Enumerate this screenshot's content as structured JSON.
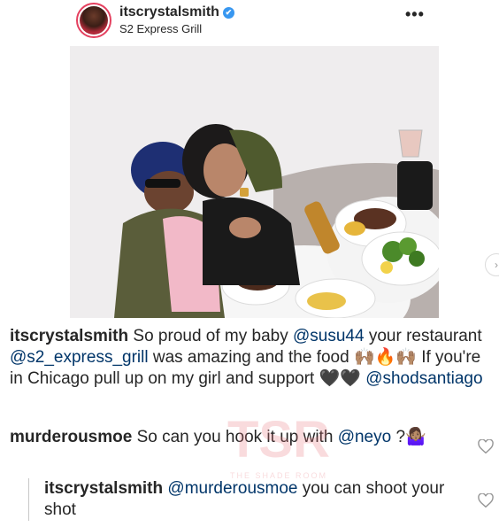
{
  "post": {
    "username": "itscrystalsmith",
    "verified_glyph": "✔",
    "location": "S2 Express Grill",
    "more_glyph": "•••",
    "next_glyph": "›"
  },
  "caption": {
    "username": "itscrystalsmith",
    "part1": " So proud of my baby ",
    "mention1": "@susu44",
    "part2": " your restaurant ",
    "mention2": "@s2_express_grill",
    "part3": " was amazing and the food ",
    "emoji1": "🙌🏽🔥🙌🏽",
    "part4": " If you're in Chicago pull up on my girl and support ",
    "emoji2": "🖤🖤",
    "part5": " ",
    "mention3": "@shodsantiago"
  },
  "comments": [
    {
      "username": "murderousmoe",
      "text": " So can you hook it up with ",
      "mention": "@neyo",
      "tail": " ?",
      "emoji": "🤷🏽‍♀️"
    }
  ],
  "reply": {
    "username": "itscrystalsmith",
    "mention": "@murderousmoe",
    "text": " you can shoot your shot"
  },
  "watermark": {
    "logo": "TSR",
    "text": "THE SHADE ROOM"
  },
  "colors": {
    "mention": "#003569",
    "verified": "#3897f0",
    "watermark": "#e8737b"
  },
  "icons": [
    "verified-badge-icon",
    "more-options-icon",
    "next-arrow-icon",
    "heart-icon"
  ]
}
